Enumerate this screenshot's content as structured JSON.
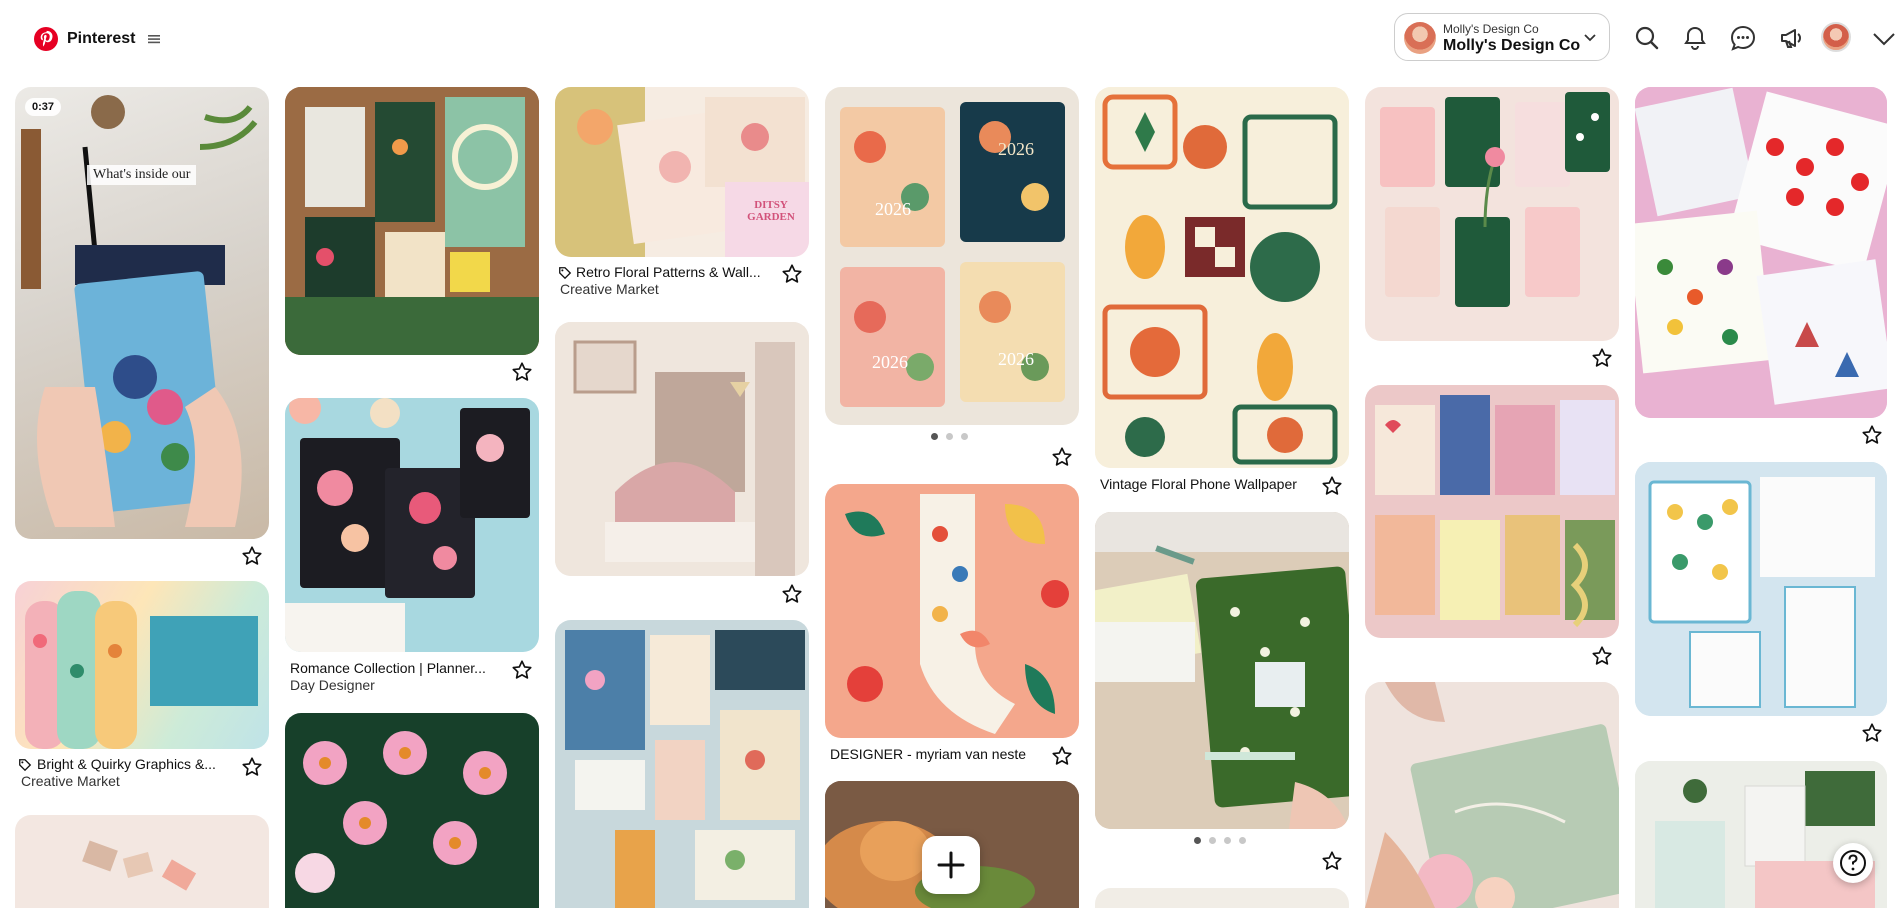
{
  "header": {
    "brand": "Pinterest",
    "account": {
      "small_label": "Molly's Design Co",
      "name": "Molly's Design Co"
    },
    "icons": [
      "search-icon",
      "notifications-icon",
      "messages-icon",
      "updates-icon",
      "profile-avatar",
      "account-switch-chevron"
    ]
  },
  "pins": [
    {
      "id": "video",
      "badge": "0:37",
      "overlay_text": "What's inside our"
    },
    {
      "id": "fabric-floral",
      "title": "Bright & Quirky Graphics &...",
      "subtitle": "Creative Market"
    },
    {
      "id": "planner-garden"
    },
    {
      "id": "romance",
      "title": "Romance Collection | Planner...",
      "subtitle": "Day Designer"
    },
    {
      "id": "daisy-garden",
      "title": "Retro Floral Patterns & Wall...",
      "subtitle": "Creative Market",
      "image_text": "DITSY GARDEN"
    },
    {
      "id": "bedroom"
    },
    {
      "id": "stationery-blue"
    },
    {
      "id": "planners-2026",
      "image_text": "2026",
      "carousel_index": 1,
      "carousel_count": 3
    },
    {
      "id": "socks",
      "title": "DESIGNER - myriam van neste"
    },
    {
      "id": "cat"
    },
    {
      "id": "vintage-floral",
      "title": "Vintage Floral Phone Wallpaper"
    },
    {
      "id": "green-planner",
      "carousel_index": 1,
      "carousel_count": 4
    },
    {
      "id": "pink-notebooks"
    },
    {
      "id": "pattern-notebooks"
    },
    {
      "id": "watercolor-cards"
    },
    {
      "id": "fruit-notebooks"
    },
    {
      "id": "blue-planners"
    },
    {
      "id": "green-gift"
    }
  ],
  "colors": {
    "brand_red": "#e60023",
    "text": "#111111",
    "muted": "#5f5f5f"
  }
}
